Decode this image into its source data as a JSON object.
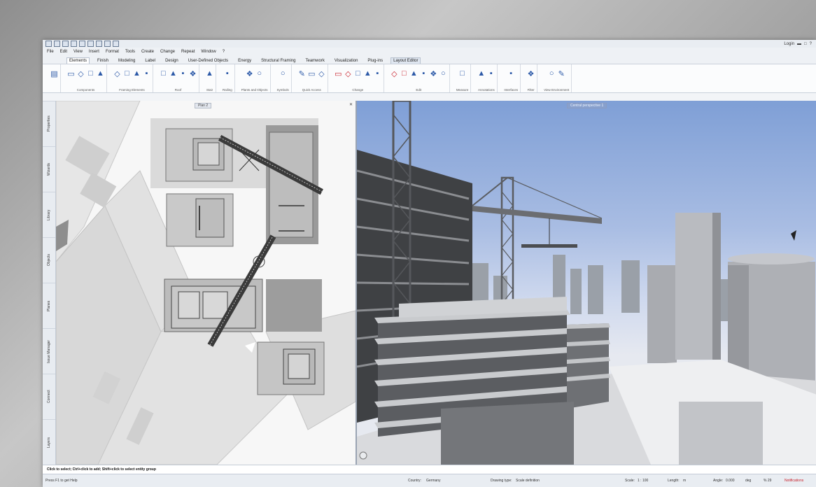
{
  "menubar": [
    "File",
    "Edit",
    "View",
    "Insert",
    "Format",
    "Tools",
    "Create",
    "Change",
    "Repeat",
    "Window",
    "?"
  ],
  "ribbon_tabs": [
    {
      "label": "Elements",
      "state": "active"
    },
    {
      "label": "Finish",
      "state": ""
    },
    {
      "label": "Modeling",
      "state": ""
    },
    {
      "label": "Label",
      "state": ""
    },
    {
      "label": "Design",
      "state": ""
    },
    {
      "label": "User-Defined Objects",
      "state": ""
    },
    {
      "label": "Energy",
      "state": ""
    },
    {
      "label": "Structural Framing",
      "state": ""
    },
    {
      "label": "Teamwork",
      "state": ""
    },
    {
      "label": "Visualization",
      "state": ""
    },
    {
      "label": "Plug-ins",
      "state": ""
    },
    {
      "label": "Layout Editor",
      "state": "highlight"
    }
  ],
  "ribbon_groups": [
    {
      "label": "Components",
      "icon_count": 4,
      "red": false
    },
    {
      "label": "Framing Elements",
      "icon_count": 4,
      "red": false
    },
    {
      "label": "Roof",
      "icon_count": 4,
      "red": false
    },
    {
      "label": "Stair",
      "icon_count": 1,
      "red": false
    },
    {
      "label": "Railing",
      "icon_count": 1,
      "red": false
    },
    {
      "label": "Plants and Objects",
      "icon_count": 2,
      "red": false
    },
    {
      "label": "Symbols",
      "icon_count": 1,
      "red": false
    },
    {
      "label": "Quick Access",
      "icon_count": 3,
      "red": false
    },
    {
      "label": "Change",
      "icon_count": 5,
      "red": true
    },
    {
      "label": "Edit",
      "icon_count": 6,
      "red": true
    },
    {
      "label": "Measure",
      "icon_count": 1,
      "red": false
    },
    {
      "label": "Annotations",
      "icon_count": 2,
      "red": false
    },
    {
      "label": "Interfaces",
      "icon_count": 1,
      "red": false
    },
    {
      "label": "Filter",
      "icon_count": 1,
      "red": false
    },
    {
      "label": "View Environment",
      "icon_count": 2,
      "red": false
    }
  ],
  "left_tabs": [
    "Properties",
    "Wizards",
    "Library",
    "Objects",
    "Planes",
    "Issue Manager",
    "Connect",
    "Layers"
  ],
  "qat_right": "Login",
  "plan_view": {
    "title": "Plan 2"
  },
  "perspective_view": {
    "title": "Central perspective 1"
  },
  "command_line": "Click to select; Ctrl+click to add; Shift+click to select entity group",
  "status": {
    "help": "Press F1 to get Help",
    "country_label": "Country:",
    "country": "Germany",
    "drawing_type_label": "Drawing type:",
    "drawing_type": "Scale definition",
    "scale_label": "Scale:",
    "scale": "1 : 100",
    "length_label": "Length:",
    "length": "m",
    "angle_label": "Angle:",
    "angle": "0.000",
    "angle_unit": "deg",
    "percent": "% 29",
    "notifications": "Notifications"
  },
  "colors": {
    "ribbon_blue": "#2d5aa8",
    "red_accent": "#c8202b"
  }
}
